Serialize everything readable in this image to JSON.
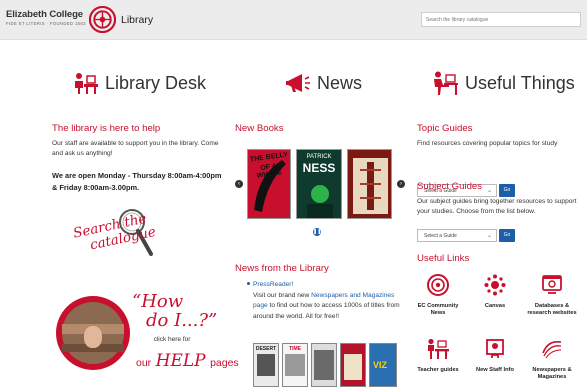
{
  "header": {
    "college_name": "Elizabeth College",
    "college_tagline": "FIDE ET LITERIS · FOUNDED 1563",
    "section_title": "Library",
    "search_placeholder": "Search the library catalogue"
  },
  "library_desk": {
    "heading": "Library Desk",
    "subheading": "The library is here to help",
    "intro": "Our staff are available to support you in the library. Come and ask us anything!",
    "hours": "We are open Monday - Thursday 8:00am-4:00pm & Friday 8:00am-3.00pm.",
    "search_catalogue_line1": "Search the",
    "search_catalogue_line2": "catalogue",
    "help_how": "“How",
    "help_do": "do I...?”",
    "help_click": "click here for",
    "help_our": "our",
    "help_help": "HELP",
    "help_pages": "pages"
  },
  "news": {
    "heading": "News",
    "new_books_heading": "New Books",
    "books": [
      {
        "title_line1": "THE BELLY",
        "title_line2": "OF A WHALE"
      },
      {
        "title_line1": "PATRICK",
        "title_line2": "NESS"
      },
      {
        "title_line1": "",
        "title_line2": ""
      }
    ],
    "news_heading": "News from the Library",
    "news_item_title": "PressReader!",
    "news_item_text_1": "Visit our brand new",
    "news_item_link": "Newspapers and Magazines page",
    "news_item_text_2": "to find out how to access 1000s of titles from around the world. All for free!!",
    "mags": [
      "DESERT",
      "TIME",
      "",
      "",
      "VIZ"
    ]
  },
  "useful": {
    "heading": "Useful Things",
    "topic_heading": "Topic Guides",
    "topic_text": "Find resources covering popular topics for study",
    "topic_select": "Select a Guide",
    "go_label": "Go",
    "subject_heading": "Subject Guides",
    "subject_text": "Our subject guides bring together resources to support your studies. Choose from the list below.",
    "subject_select": "Select a Guide",
    "links_heading": "Useful Links",
    "links": [
      {
        "label": "EC Community News",
        "icon": "ec-logo-icon"
      },
      {
        "label": "Canvas",
        "icon": "canvas-icon"
      },
      {
        "label": "Databases & research websites",
        "icon": "databases-icon"
      },
      {
        "label": "Teacher guides",
        "icon": "teacher-icon"
      },
      {
        "label": "New Staff Info",
        "icon": "new-staff-icon"
      },
      {
        "label": "Newspapers & Magazines",
        "icon": "newspaper-icon"
      }
    ]
  },
  "colors": {
    "accent": "#c8102e",
    "link": "#1c5fa8",
    "header_bg": "#ececec"
  }
}
